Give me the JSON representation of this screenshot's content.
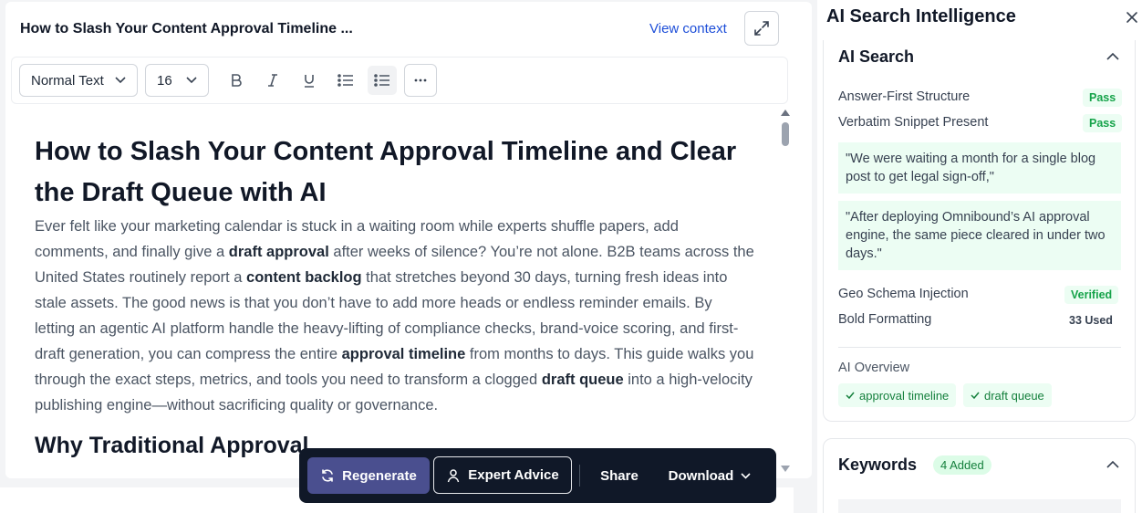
{
  "editor": {
    "doc_title": "How to Slash Your Content Approval Timeline ...",
    "view_context": "View context",
    "toolbar": {
      "text_style": "Normal Text",
      "font_size": "16"
    },
    "heading": "How to Slash Your Content Approval Timeline and Clear the Draft Queue with AI",
    "paragraph": {
      "s1": "Ever felt like your marketing calendar is stuck in a waiting room while experts shuffle papers, add comments, and finally give a ",
      "b1": "draft approval",
      "s2": " after weeks of silence? You’re not alone. B2B teams across the United States routinely report a ",
      "b2": "content backlog",
      "s3": " that stretches beyond 30 days, turning fresh ideas into stale assets. The good news is that you don’t have to add more heads or endless reminder emails. By letting an agentic AI platform handle the heavy-lifting of compliance checks, brand-voice scoring, and first-draft generation, you can compress the entire ",
      "b3": "approval timeline",
      "s4": " from months to days. This guide walks you through the exact steps, metrics, and tools you need to transform a clogged ",
      "b4": "draft queue",
      "s5": " into a high-velocity publishing engine—without sacrificing quality or governance."
    },
    "subheading": "Why Traditional Approval"
  },
  "action_bar": {
    "regenerate": "Regenerate",
    "expert_advice": "Expert Advice",
    "share": "Share",
    "download": "Download"
  },
  "panel": {
    "title": "AI Search Intelligence",
    "ai_search": {
      "title": "AI Search",
      "rows": [
        {
          "label": "Answer-First Structure",
          "badge": "Pass"
        },
        {
          "label": "Verbatim Snippet Present",
          "badge": "Pass"
        }
      ],
      "quotes": [
        "\"We were waiting a month for a single blog post to get legal sign-off,\"",
        "\"After deploying Omnibound’s AI approval engine, the same piece cleared in under two days.\""
      ],
      "rows2": [
        {
          "label": "Geo Schema Injection",
          "badge": "Verified"
        },
        {
          "label": "Bold Formatting",
          "badge": "33 Used"
        }
      ],
      "overview_label": "AI Overview",
      "tags": [
        "approval timeline",
        "draft queue"
      ]
    },
    "keywords": {
      "title": "Keywords",
      "badge": "4 Added"
    }
  },
  "colors": {
    "accent_green": "#16a34a",
    "regen_bg": "#4a4f8f",
    "action_bar_bg": "#101828",
    "link_blue": "#1d4ed8"
  }
}
